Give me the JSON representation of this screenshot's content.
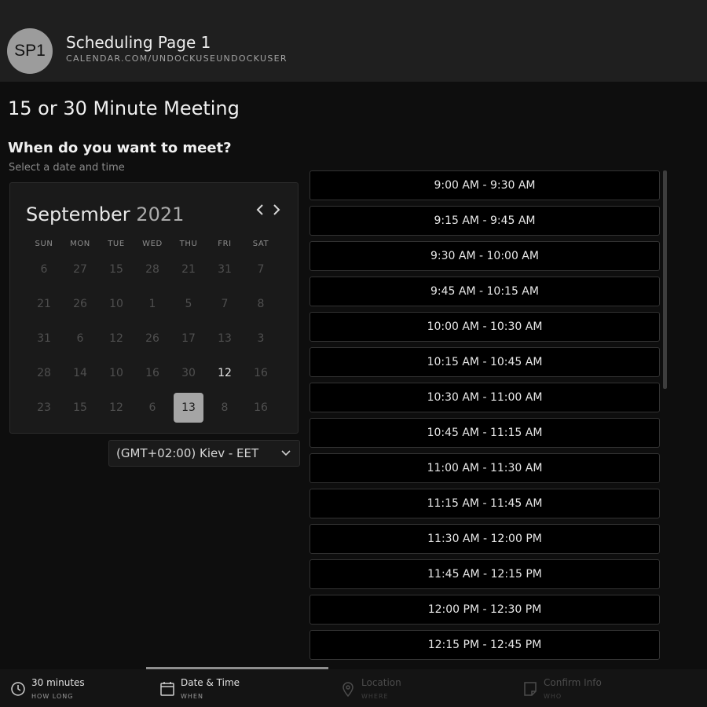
{
  "header": {
    "avatar_initials": "SP1",
    "page_name": "Scheduling Page 1",
    "page_url": "CALENDAR.COM/UNDOCKUSEUNDOCKUSER"
  },
  "meeting": {
    "title": "15 or 30 Minute Meeting",
    "question": "When do you want to meet?",
    "hint": "Select a date and time"
  },
  "calendar": {
    "month": "September",
    "year": "2021",
    "weekdays": [
      "SUN",
      "MON",
      "TUE",
      "WED",
      "THU",
      "FRI",
      "SAT"
    ],
    "days": [
      {
        "d": "6",
        "s": "disabled"
      },
      {
        "d": "27",
        "s": "disabled"
      },
      {
        "d": "15",
        "s": "disabled"
      },
      {
        "d": "28",
        "s": "disabled"
      },
      {
        "d": "21",
        "s": "disabled"
      },
      {
        "d": "31",
        "s": "disabled"
      },
      {
        "d": "7",
        "s": "disabled"
      },
      {
        "d": "21",
        "s": "disabled"
      },
      {
        "d": "26",
        "s": "disabled"
      },
      {
        "d": "10",
        "s": "disabled"
      },
      {
        "d": "1",
        "s": "disabled"
      },
      {
        "d": "5",
        "s": "disabled"
      },
      {
        "d": "7",
        "s": "disabled"
      },
      {
        "d": "8",
        "s": "disabled"
      },
      {
        "d": "31",
        "s": "disabled"
      },
      {
        "d": "6",
        "s": "disabled"
      },
      {
        "d": "12",
        "s": "disabled"
      },
      {
        "d": "26",
        "s": "disabled"
      },
      {
        "d": "17",
        "s": "disabled"
      },
      {
        "d": "13",
        "s": "disabled"
      },
      {
        "d": "3",
        "s": "disabled"
      },
      {
        "d": "28",
        "s": "disabled"
      },
      {
        "d": "14",
        "s": "disabled"
      },
      {
        "d": "10",
        "s": "disabled"
      },
      {
        "d": "16",
        "s": "disabled"
      },
      {
        "d": "30",
        "s": "disabled"
      },
      {
        "d": "12",
        "s": "available"
      },
      {
        "d": "16",
        "s": "disabled"
      },
      {
        "d": "23",
        "s": "disabled"
      },
      {
        "d": "15",
        "s": "disabled"
      },
      {
        "d": "12",
        "s": "disabled"
      },
      {
        "d": "6",
        "s": "disabled"
      },
      {
        "d": "13",
        "s": "selected"
      },
      {
        "d": "8",
        "s": "disabled"
      },
      {
        "d": "16",
        "s": "disabled"
      }
    ]
  },
  "timezone": {
    "value": "(GMT+02:00) Kiev - EET"
  },
  "time_slots": [
    "9:00 AM - 9:30 AM",
    "9:15 AM - 9:45 AM",
    "9:30 AM - 10:00 AM",
    "9:45 AM - 10:15 AM",
    "10:00 AM - 10:30 AM",
    "10:15 AM - 10:45 AM",
    "10:30 AM - 11:00 AM",
    "10:45 AM - 11:15 AM",
    "11:00 AM - 11:30 AM",
    "11:15 AM - 11:45 AM",
    "11:30 AM - 12:00 PM",
    "11:45 AM - 12:15 PM",
    "12:00 PM - 12:30 PM",
    "12:15 PM - 12:45 PM"
  ],
  "steps": [
    {
      "label": "30 minutes",
      "sub": "HOW LONG",
      "icon": "clock-icon",
      "state": "active"
    },
    {
      "label": "Date & Time",
      "sub": "WHEN",
      "icon": "calendar-icon",
      "state": "active"
    },
    {
      "label": "Location",
      "sub": "WHERE",
      "icon": "map-pin-icon",
      "state": "inactive"
    },
    {
      "label": "Confirm Info",
      "sub": "WHO",
      "icon": "note-icon",
      "state": "inactive"
    }
  ],
  "progress": {
    "current_step": 2,
    "total_steps": 4
  },
  "colors": {
    "background": "#0e0e0e",
    "header": "#1f1f1f",
    "selected_day": "#a5a5a5",
    "slot_background": "#000000"
  }
}
